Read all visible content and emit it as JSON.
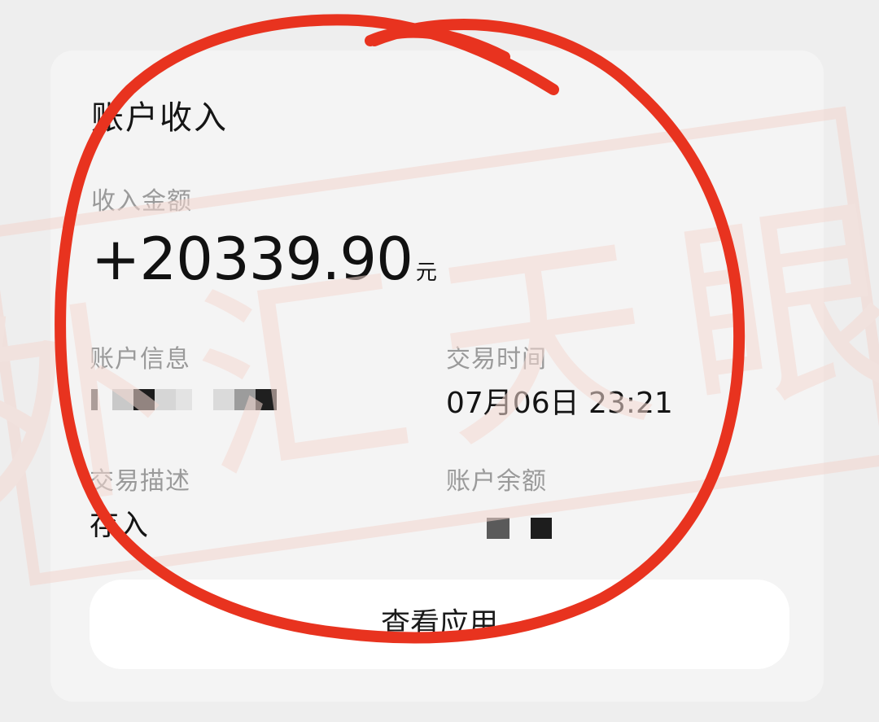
{
  "card": {
    "title": "账户收入",
    "income_label": "收入金额",
    "income_amount": "+20339.90",
    "income_unit": "元",
    "account_info_label": "账户信息",
    "account_info_value": "[redacted]",
    "trade_time_label": "交易时间",
    "trade_time_value": "07月06日 23:21",
    "trade_desc_label": "交易描述",
    "trade_desc_value": "存入",
    "balance_label": "账户余额",
    "balance_value": "[redacted]",
    "action_button_label": "查看应用"
  },
  "watermark_text": "外汇天眼",
  "colors": {
    "background": "#eeeeee",
    "card": "#f4f4f4",
    "button": "#ffffff",
    "label": "#9a9a9a",
    "text": "#141414",
    "annotation_circle": "#e8331f",
    "watermark": "#f2cfc8"
  }
}
